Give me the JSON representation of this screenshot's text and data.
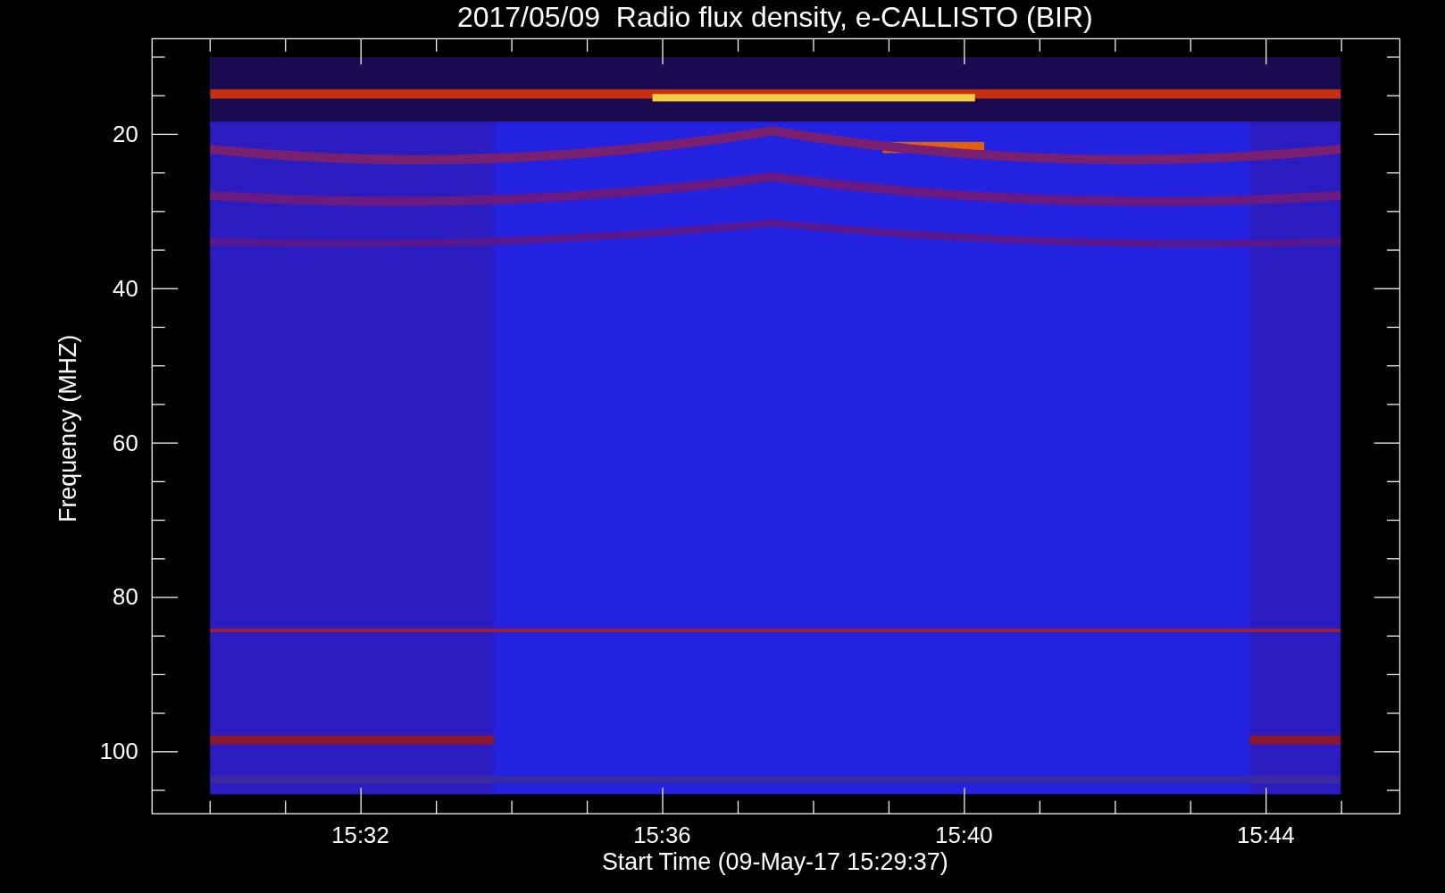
{
  "title": "2017/05/09  Radio flux density, e-CALLISTO (BIR)",
  "y_axis": {
    "label": "Frequency (MHZ)",
    "ticks": [
      "20",
      "40",
      "60",
      "80",
      "100"
    ]
  },
  "x_axis": {
    "label": "Start Time (09-May-17 15:29:37)",
    "ticks": [
      "15:32",
      "15:36",
      "15:40",
      "15:44"
    ]
  }
}
